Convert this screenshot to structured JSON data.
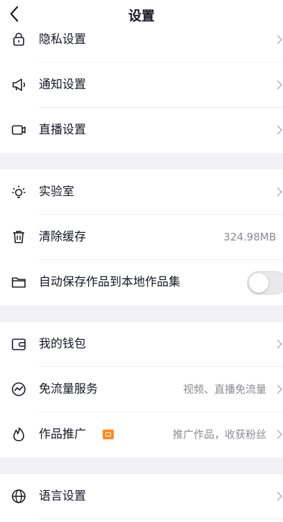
{
  "header": {
    "title": "设置"
  },
  "groups": [
    {
      "items": [
        {
          "label": "隐私设置",
          "icon": "lock-icon"
        },
        {
          "label": "通知设置",
          "icon": "megaphone-icon"
        },
        {
          "label": "直播设置",
          "icon": "video-camera-icon"
        }
      ]
    },
    {
      "items": [
        {
          "label": "实验室",
          "icon": "lightbulb-icon"
        },
        {
          "label": "清除缓存",
          "icon": "trash-icon",
          "value": "324.98MB"
        },
        {
          "label": "自动保存作品到本地作品集",
          "icon": "folder-icon",
          "toggle": false
        }
      ]
    },
    {
      "items": [
        {
          "label": "我的钱包",
          "icon": "wallet-icon"
        },
        {
          "label": "免流量服务",
          "icon": "traffic-icon",
          "value": "视频、直播免流量"
        },
        {
          "label": "作品推广",
          "icon": "flame-icon",
          "value": "推广作品，收获粉丝",
          "badge_color": "#ff8a1e"
        }
      ]
    },
    {
      "items": [
        {
          "label": "语言设置",
          "icon": "globe-icon"
        }
      ]
    }
  ],
  "colors": {
    "separator": "#f2f2f4",
    "secondary_text": "#8a8b91",
    "badge": "#ff8a1e"
  }
}
